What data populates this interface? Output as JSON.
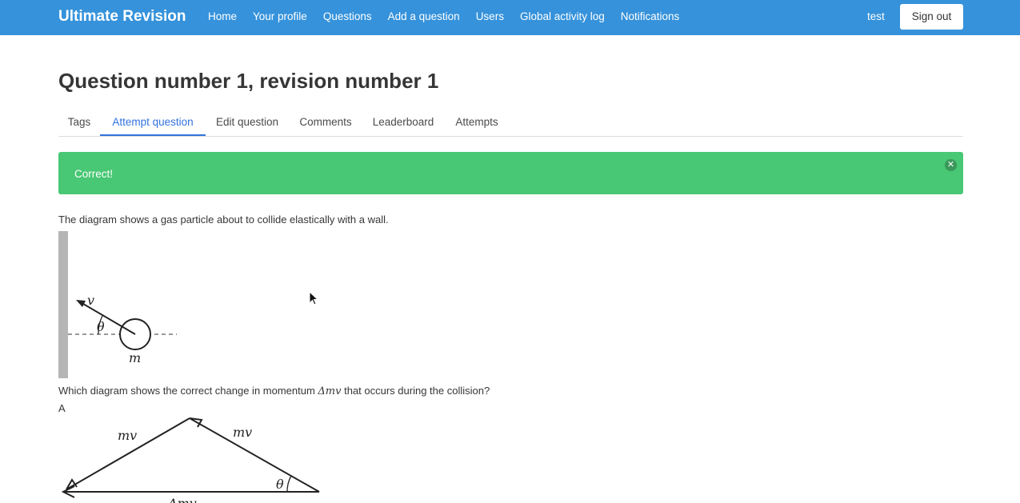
{
  "nav": {
    "brand": "Ultimate Revision",
    "items": [
      "Home",
      "Your profile",
      "Questions",
      "Add a question",
      "Users",
      "Global activity log",
      "Notifications"
    ],
    "user": "test",
    "signout_label": "Sign out"
  },
  "page": {
    "title": "Question number 1, revision number 1"
  },
  "tabs": [
    {
      "label": "Tags",
      "active": false
    },
    {
      "label": "Attempt question",
      "active": true
    },
    {
      "label": "Edit question",
      "active": false
    },
    {
      "label": "Comments",
      "active": false
    },
    {
      "label": "Leaderboard",
      "active": false
    },
    {
      "label": "Attempts",
      "active": false
    }
  ],
  "alert": {
    "text": "Correct!",
    "color": "#48c774",
    "close_icon": "close-icon"
  },
  "question": {
    "intro": "The diagram shows a gas particle about to collide elastically with a wall.",
    "prompt_before": "Which diagram shows the correct change in momentum ",
    "prompt_math": "Δmv",
    "prompt_after": " that occurs during the collision?",
    "option_a_label": "A"
  },
  "diagram1": {
    "velocity_label": "v",
    "angle_label": "θ",
    "mass_label": "m"
  },
  "diagram2": {
    "side_left_label": "mv",
    "side_right_label": "mv",
    "angle_label": "θ",
    "base_label": "Δmv"
  },
  "colors": {
    "navbar": "#3592db",
    "accent": "#3273dc",
    "success": "#48c774"
  }
}
